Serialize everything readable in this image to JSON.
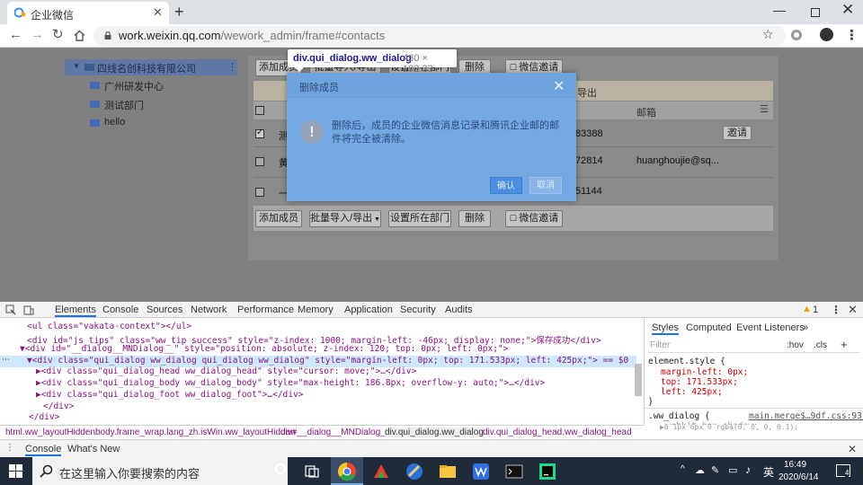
{
  "browser": {
    "tab_title": "企业微信",
    "url_host": "work.weixin.qq.com",
    "url_path": "/wework_admin/frame#contacts"
  },
  "sidebar": {
    "company": "四线名创科技有限公司",
    "items": [
      {
        "label": "广州研发中心"
      },
      {
        "label": "测试部门"
      },
      {
        "label": "hello"
      }
    ]
  },
  "toolbar": {
    "add_member": "添加成员",
    "import_export": "批量导入/导出",
    "set_department": "设置所在部门",
    "delete": "删除",
    "wechat_invite": "微信邀请"
  },
  "notice": "导出",
  "table": {
    "header_email": "邮箱",
    "rows": [
      {
        "name": "测",
        "phone": "83388",
        "email": "",
        "action": "邀请"
      },
      {
        "name": "黄",
        "phone": "72814",
        "email": "huanghoujie@sq...",
        "action": ""
      },
      {
        "name": "一",
        "phone": "51144",
        "email": "",
        "action": ""
      }
    ]
  },
  "dialog": {
    "title": "删除成员",
    "message": "删除后，成员的企业微信消息记录和腾讯企业邮的邮件将完全被清除。",
    "confirm": "确认",
    "cancel": "取消"
  },
  "inspect_tip": {
    "name": "div.qui_dialog.ww_dialog",
    "size": "430 × 192.33"
  },
  "devtools": {
    "tabs": [
      "Elements",
      "Console",
      "Sources",
      "Network",
      "Performance",
      "Memory",
      "Application",
      "Security",
      "Audits"
    ],
    "warnings": "1",
    "dom": [
      "<ul class=\"vakata-context\"></ul>",
      "<div id=\"js_tips\" class=\"ww_tip success\" style=\"z-index: 1000; margin-left: -46px; display: none;\">保存成功</div>",
      "▼<div id=\"__dialog__MNDialog__\" style=\"position: absolute; z-index: 120; top: 0px; left: 0px;\">",
      "▼<div class=\"qui_dialog ww_dialog qui_dialog ww_dialog\" style=\"margin-left: 0px; top: 171.533px; left: 425px;\"> == $0",
      "▶<div class=\"qui_dialog_head ww_dialog_head\" style=\"cursor: move;\">…</div>",
      "▶<div class=\"qui_dialog_body ww_dialog_body\" style=\"max-height: 186.8px; overflow-y: auto;\">…</div>",
      "▶<div class=\"qui_dialog_foot ww_dialog_foot\">…</div>",
      "</div>",
      "</div>"
    ],
    "styles_tabs": [
      "Styles",
      "Computed",
      "Event Listeners"
    ],
    "filter_placeholder": "Filter",
    "hov": ":hov",
    "cls": ".cls",
    "element_style": "element.style {",
    "css_props": [
      "margin-left: 0px;",
      "top: 171.533px;",
      "left: 425px;"
    ],
    "close_brace": "}",
    "rule_selector": ".ww_dialog {",
    "rule_source": "main.merge$…9df.css:931",
    "rule_prop": "-webkit-box-shadow:",
    "rule_prop2": "▶0 1px 6px 0 rgba(0, 0, 0, 0.1);",
    "breadcrumbs": [
      "html.ww_layoutHidden",
      "body.frame_wrap.lang_zh.isWin.ww_layoutHidden",
      "div#__dialog__MNDialog__",
      "div.qui_dialog.ww_dialog",
      "div.qui_dialog_head.ww_dialog_head"
    ],
    "console_tabs": [
      "Console",
      "What's New"
    ]
  },
  "taskbar": {
    "search_placeholder": "在这里输入你要搜索的内容",
    "ime": "英",
    "time": "16:49",
    "date": "2020/6/14",
    "notifications": "4"
  }
}
